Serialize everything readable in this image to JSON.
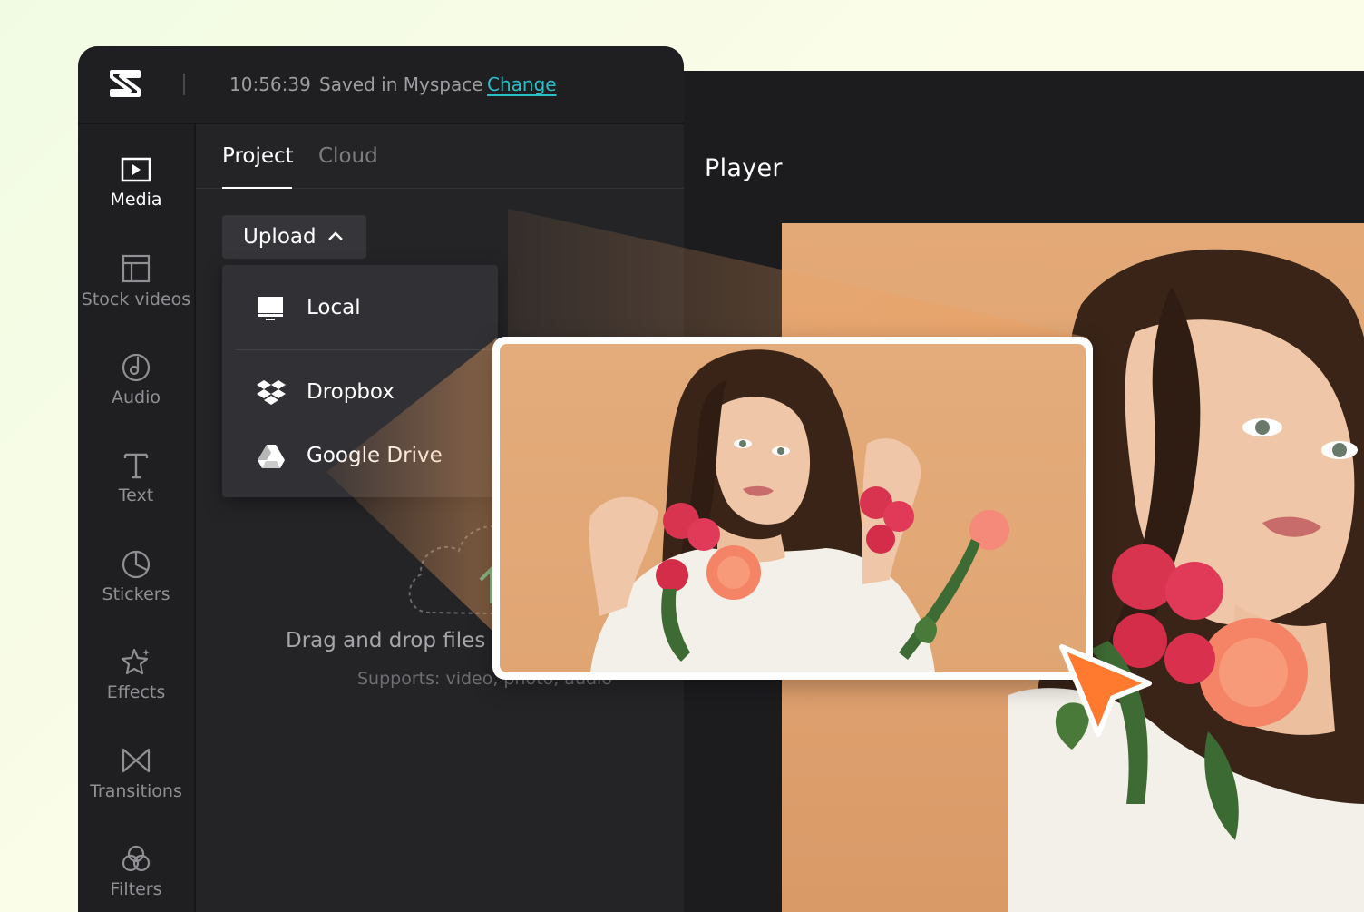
{
  "header": {
    "logo": "capcut-logo-icon",
    "save_time": "10:56:39",
    "save_status": "Saved in Myspace",
    "change_label": "Change"
  },
  "sidebar": {
    "items": [
      {
        "label": "Media",
        "icon": "media-icon",
        "active": true
      },
      {
        "label": "Stock videos",
        "icon": "stock-videos-icon"
      },
      {
        "label": "Audio",
        "icon": "audio-icon"
      },
      {
        "label": "Text",
        "icon": "text-icon"
      },
      {
        "label": "Stickers",
        "icon": "stickers-icon"
      },
      {
        "label": "Effects",
        "icon": "effects-icon"
      },
      {
        "label": "Transitions",
        "icon": "transitions-icon"
      },
      {
        "label": "Filters",
        "icon": "filters-icon"
      }
    ]
  },
  "panel": {
    "tabs": [
      {
        "label": "Project",
        "active": true
      },
      {
        "label": "Cloud"
      }
    ],
    "upload_label": "Upload",
    "upload_menu": [
      {
        "label": "Local",
        "icon": "monitor-icon"
      },
      {
        "label": "Dropbox",
        "icon": "dropbox-icon"
      },
      {
        "label": "Google Drive",
        "icon": "google-drive-icon"
      }
    ],
    "drag_text": "Drag and drop files fr",
    "supports_text": "Supports: video, photo, audio"
  },
  "player": {
    "title": "Player"
  },
  "colors": {
    "accent_link": "#27c0c9",
    "cursor": "#ff7a2f",
    "panel_bg": "#242427",
    "upload_arrow": "#3dbf9a"
  }
}
